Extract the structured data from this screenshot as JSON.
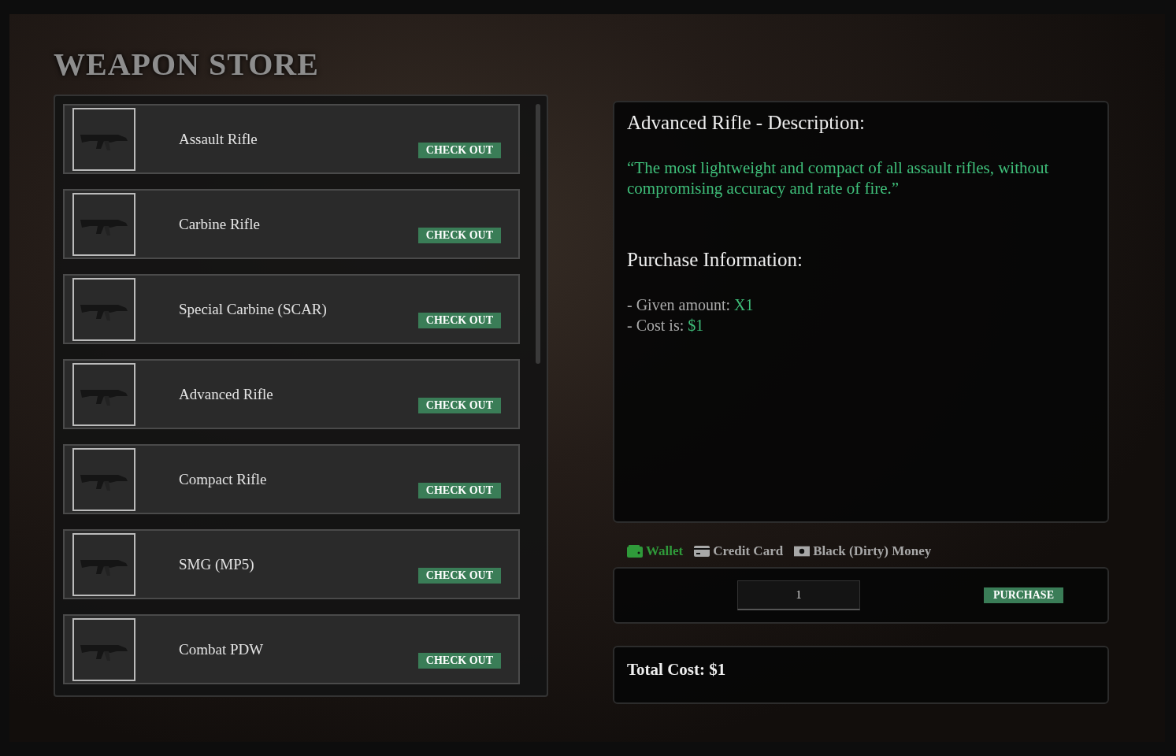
{
  "title": "WEAPON STORE",
  "weapons": [
    {
      "name": "Assault Rifle",
      "button": "CHECK OUT"
    },
    {
      "name": "Carbine Rifle",
      "button": "CHECK OUT"
    },
    {
      "name": "Special Carbine (SCAR)",
      "button": "CHECK OUT"
    },
    {
      "name": "Advanced Rifle",
      "button": "CHECK OUT"
    },
    {
      "name": "Compact Rifle",
      "button": "CHECK OUT"
    },
    {
      "name": "SMG (MP5)",
      "button": "CHECK OUT"
    },
    {
      "name": "Combat PDW",
      "button": "CHECK OUT"
    }
  ],
  "description": {
    "heading": "Advanced Rifle - Description:",
    "quote": "“The most lightweight and compact of all assault rifles, without compromising accuracy and rate of fire.”"
  },
  "purchase_info": {
    "heading": "Purchase Information:",
    "lines": [
      {
        "label": "- Given amount:",
        "value": "X1"
      },
      {
        "label": "- Cost is:",
        "value": "$1"
      }
    ]
  },
  "payment_methods": [
    {
      "kind": "wallet",
      "label": "Wallet",
      "selected": true
    },
    {
      "kind": "card",
      "label": "Credit Card",
      "selected": false
    },
    {
      "kind": "cash",
      "label": "Black (Dirty) Money",
      "selected": false
    }
  ],
  "quantity": {
    "value": "1"
  },
  "purchase_button": "PURCHASE",
  "total": "Total Cost: $1"
}
